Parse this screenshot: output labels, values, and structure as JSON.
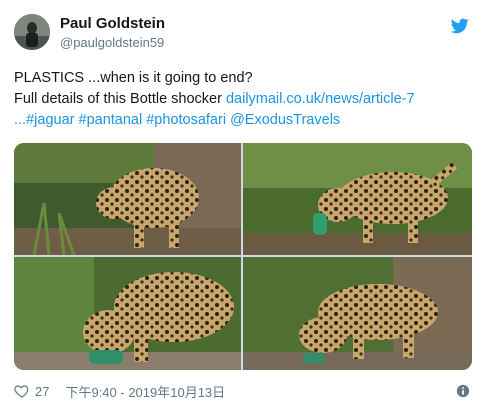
{
  "user": {
    "name": "Paul Goldstein",
    "handle": "@paulgoldstein59"
  },
  "tweet": {
    "line1": "PLASTICS ...when is it going to end?",
    "line2_prefix": "Full details of this Bottle shocker ",
    "line2_link": "dailymail.co.uk/news/article-7",
    "line3_link": "...",
    "hashtags": [
      "#jaguar",
      "#pantanal",
      "#photosafari"
    ],
    "mention": "@ExodusTravels"
  },
  "footer": {
    "likes": "27",
    "timestamp": "下午9:40 - 2019年10月13日"
  },
  "icons": {
    "brand": "twitter-bird-icon",
    "like": "heart-icon",
    "info": "info-icon"
  },
  "colors": {
    "link": "#1b95e0",
    "brand": "#1da1f2",
    "muted": "#657786"
  }
}
